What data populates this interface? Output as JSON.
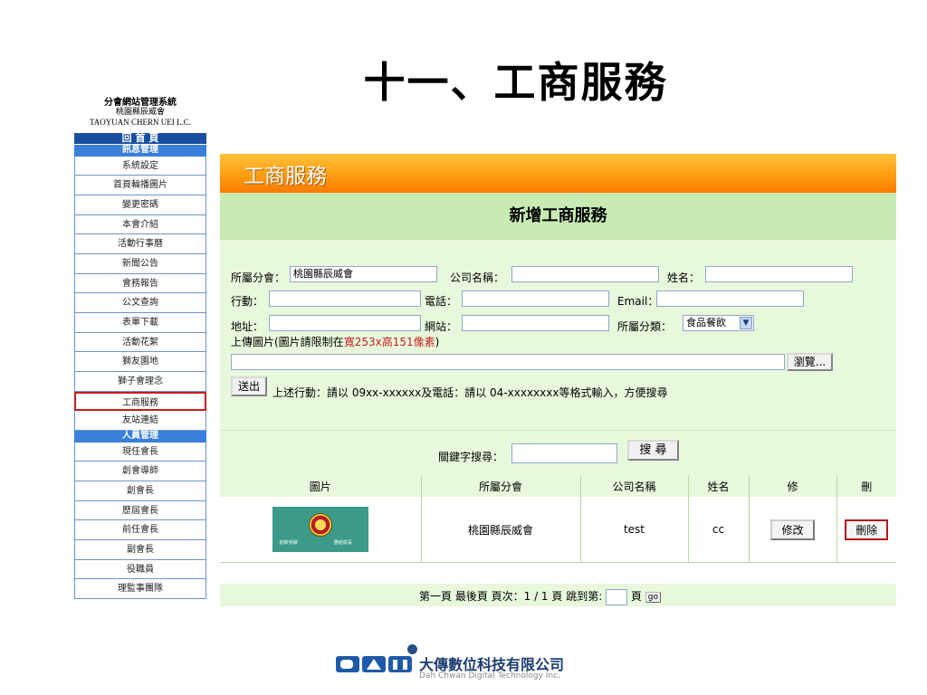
{
  "slide_title": "十一、工商服務",
  "sidebar": {
    "system_title": "分會網站管理系統",
    "org_name": "桃園縣辰威會",
    "org_name_en": "TAOYUAN CHERN UEI L.C.",
    "home": "回 首 頁",
    "cat1": "訊息管理",
    "items1": [
      "系統設定",
      "首頁輪播圖片",
      "變更密碼",
      "本會介紹",
      "活動行事曆",
      "新聞公告",
      "會務報告",
      "公文查詢",
      "表單下載",
      "活動花絮",
      "獅友園地",
      "獅子會理念",
      "工商服務",
      "友站連結"
    ],
    "cat2": "人員管理",
    "items2": [
      "現任會長",
      "創會導師",
      "創會長",
      "歷屆會長",
      "前任會長",
      "副會長",
      "役職員",
      "理監事團隊"
    ]
  },
  "panel": {
    "header": "工商服務",
    "subheader": "新增工商服務",
    "form": {
      "branch_label": "所屬分會：",
      "branch_value": "桃園縣辰威會",
      "company_label": "公司名稱：",
      "name_label": "姓名：",
      "mobile_label": "行動：",
      "phone_label": "電話：",
      "email_label": "Email：",
      "address_label": "地址：",
      "website_label": "網站：",
      "category_label": "所屬分類：",
      "category_value": "食品餐飲",
      "upload_label": "上傳圖片(圖片請限制在",
      "upload_limit": "寬253x高151像素",
      "upload_close": ")",
      "browse_label": "瀏覽...",
      "submit_label": "送出",
      "hint": "上述行動：請以 09xx-xxxxxx及電話：請以 04-xxxxxxxx等格式輸入，方便搜尋"
    },
    "search": {
      "label": "關鍵字搜尋：",
      "button": "搜 尋"
    },
    "table": {
      "headers": [
        "圖片",
        "所屬分會",
        "公司名稱",
        "姓名",
        "修",
        "刪"
      ],
      "rows": [
        {
          "branch": "桃園縣辰威會",
          "company": "test",
          "name": "cc",
          "edit": "修改",
          "delete": "刪除",
          "thumb_cap_left": "創新突破",
          "thumb_cap_right": "團結成長"
        }
      ]
    },
    "pager": {
      "text": "第一頁 最後頁 頁次：1 / 1 頁 跳到第:",
      "page_suffix": "頁",
      "go": "go"
    }
  },
  "footer_logo": {
    "mark": "DAH",
    "cn": "大傳數位科技有限公司",
    "en": "Dah Chwan Digital Technology Inc."
  },
  "colors": {
    "sidebar_home": "#1a4fa0",
    "sidebar_cat": "#3b7fdc",
    "header_orange": "#ff9a10",
    "sub_green": "#c7ebb3",
    "form_green": "#e8f8dc",
    "active_border": "#c41e1e"
  }
}
